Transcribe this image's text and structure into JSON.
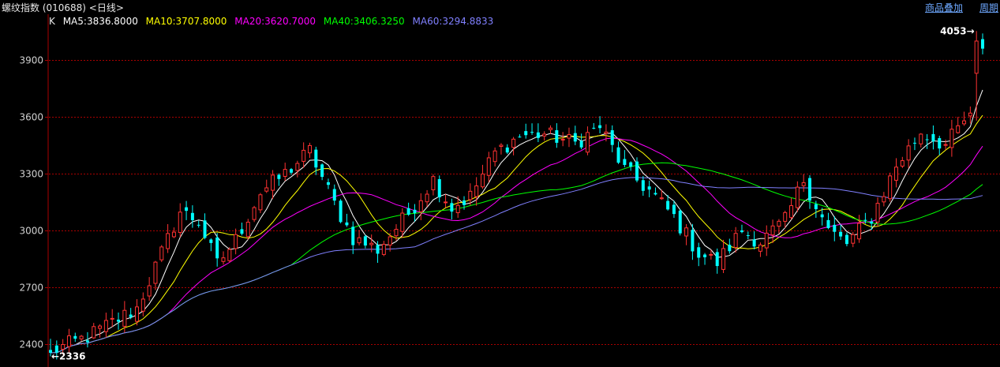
{
  "header": {
    "title": "螺纹指数 (010688) <日线>",
    "link_overlay": "商品叠加",
    "link_period": "周期"
  },
  "legend": {
    "k_label": "K",
    "items": [
      {
        "text": "MA5:3836.8000",
        "color": "#ffffff"
      },
      {
        "text": "MA10:3707.8000",
        "color": "#ffff00"
      },
      {
        "text": "MA20:3620.7000",
        "color": "#ff00ff"
      },
      {
        "text": "MA40:3406.3250",
        "color": "#00ff00"
      },
      {
        "text": "MA60:3294.8833",
        "color": "#8080ff"
      }
    ]
  },
  "colors": {
    "up": "#ff3232",
    "down": "#00ffff",
    "grid": "#aa0000",
    "axis": "#aa0000"
  },
  "chart_data": {
    "type": "candlestick",
    "ylim": [
      2280,
      4100
    ],
    "yticks": [
      2400,
      2700,
      3000,
      3300,
      3600,
      3900
    ],
    "annotations": {
      "high_label": "4053",
      "low_label": "2336"
    },
    "anchors": [
      [
        0,
        2360
      ],
      [
        6,
        2440
      ],
      [
        14,
        2590
      ],
      [
        18,
        2880
      ],
      [
        21,
        3100
      ],
      [
        24,
        3050
      ],
      [
        27,
        2820
      ],
      [
        30,
        2950
      ],
      [
        34,
        3200
      ],
      [
        38,
        3300
      ],
      [
        42,
        3420
      ],
      [
        46,
        3140
      ],
      [
        49,
        2960
      ],
      [
        53,
        2900
      ],
      [
        58,
        3090
      ],
      [
        62,
        3270
      ],
      [
        65,
        3120
      ],
      [
        68,
        3180
      ],
      [
        72,
        3410
      ],
      [
        76,
        3500
      ],
      [
        80,
        3510
      ],
      [
        85,
        3460
      ],
      [
        89,
        3550
      ],
      [
        93,
        3320
      ],
      [
        97,
        3210
      ],
      [
        101,
        3070
      ],
      [
        105,
        2880
      ],
      [
        108,
        2830
      ],
      [
        112,
        3000
      ],
      [
        115,
        2940
      ],
      [
        119,
        3050
      ],
      [
        122,
        3270
      ],
      [
        126,
        3000
      ],
      [
        129,
        2930
      ],
      [
        133,
        3070
      ],
      [
        137,
        3340
      ],
      [
        141,
        3520
      ],
      [
        145,
        3450
      ],
      [
        149,
        3620
      ],
      [
        150,
        3960
      ],
      [
        151,
        4000
      ]
    ],
    "ma": [
      {
        "name": "MA5",
        "color": "#ffffff",
        "period": 5
      },
      {
        "name": "MA10",
        "color": "#ffff00",
        "period": 10
      },
      {
        "name": "MA20",
        "color": "#ff00ff",
        "period": 20
      },
      {
        "name": "MA40",
        "color": "#00ff00",
        "period": 40
      },
      {
        "name": "MA60",
        "color": "#8080ff",
        "period": 60
      }
    ]
  }
}
